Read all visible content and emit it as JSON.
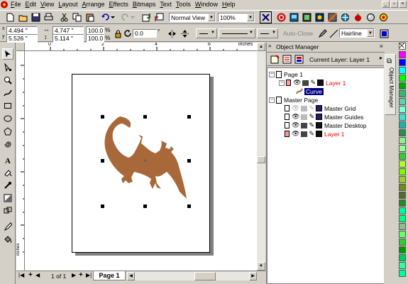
{
  "menu": [
    "File",
    "Edit",
    "View",
    "Layout",
    "Arrange",
    "Effects",
    "Bitmaps",
    "Text",
    "Tools",
    "Window",
    "Help"
  ],
  "toolbar": {
    "view_mode": "Normal View",
    "zoom": "100%"
  },
  "propbar": {
    "x": "4.494 \"",
    "y": "5.526 \"",
    "w": "4.747 \"",
    "h": "5.114 \"",
    "scale_x": "100.0",
    "scale_y": "100.0",
    "pct": "%",
    "rotation": "0.0",
    "deg": "°",
    "autoclose": "Auto-Close",
    "outline": "Hairline"
  },
  "ruler": {
    "unit": "inches",
    "labels": [
      "0",
      "2",
      "4",
      "6"
    ]
  },
  "page_nav": {
    "counter": "1 of 1",
    "tab": "Page 1"
  },
  "object_manager": {
    "title": "Object Manager",
    "current_layer": "Current Layer: Layer 1",
    "side_tab": "Object Manager",
    "tree": {
      "page": "Page 1",
      "layer": "Layer 1",
      "object": "Curve",
      "master_page": "Master Page",
      "master_layers": [
        "Master Grid",
        "Master Guides",
        "Master Desktop",
        "Layer 1"
      ]
    }
  },
  "colors": {
    "lizard": "#a8683a",
    "accent": "#000080",
    "palette": [
      "#ffffff",
      "#ff00ff",
      "#0000ff",
      "#00ffff",
      "#00ff00",
      "#00aa00",
      "#3cb371",
      "#66cdaa",
      "#7fffd4",
      "#40e0d0",
      "#20b2aa",
      "#2e8b57",
      "#90ee90",
      "#98fb98",
      "#32cd32",
      "#adff2f",
      "#7cfc00",
      "#9acd32",
      "#6b8e23",
      "#556b2f",
      "#228b22",
      "#00fa9a",
      "#00ff7f",
      "#8fbc8f",
      "#66ff66",
      "#33cc33",
      "#009900",
      "#00cc66",
      "#33ff99",
      "#00ff99",
      "#66ffcc",
      "#99ffcc",
      "#ccffcc",
      "#ccff99",
      "#99ff66",
      "#66cc66",
      "#339933",
      "#006600",
      "#00bb44",
      "#22dd55",
      "#44ee66",
      "#66ff77"
    ]
  }
}
